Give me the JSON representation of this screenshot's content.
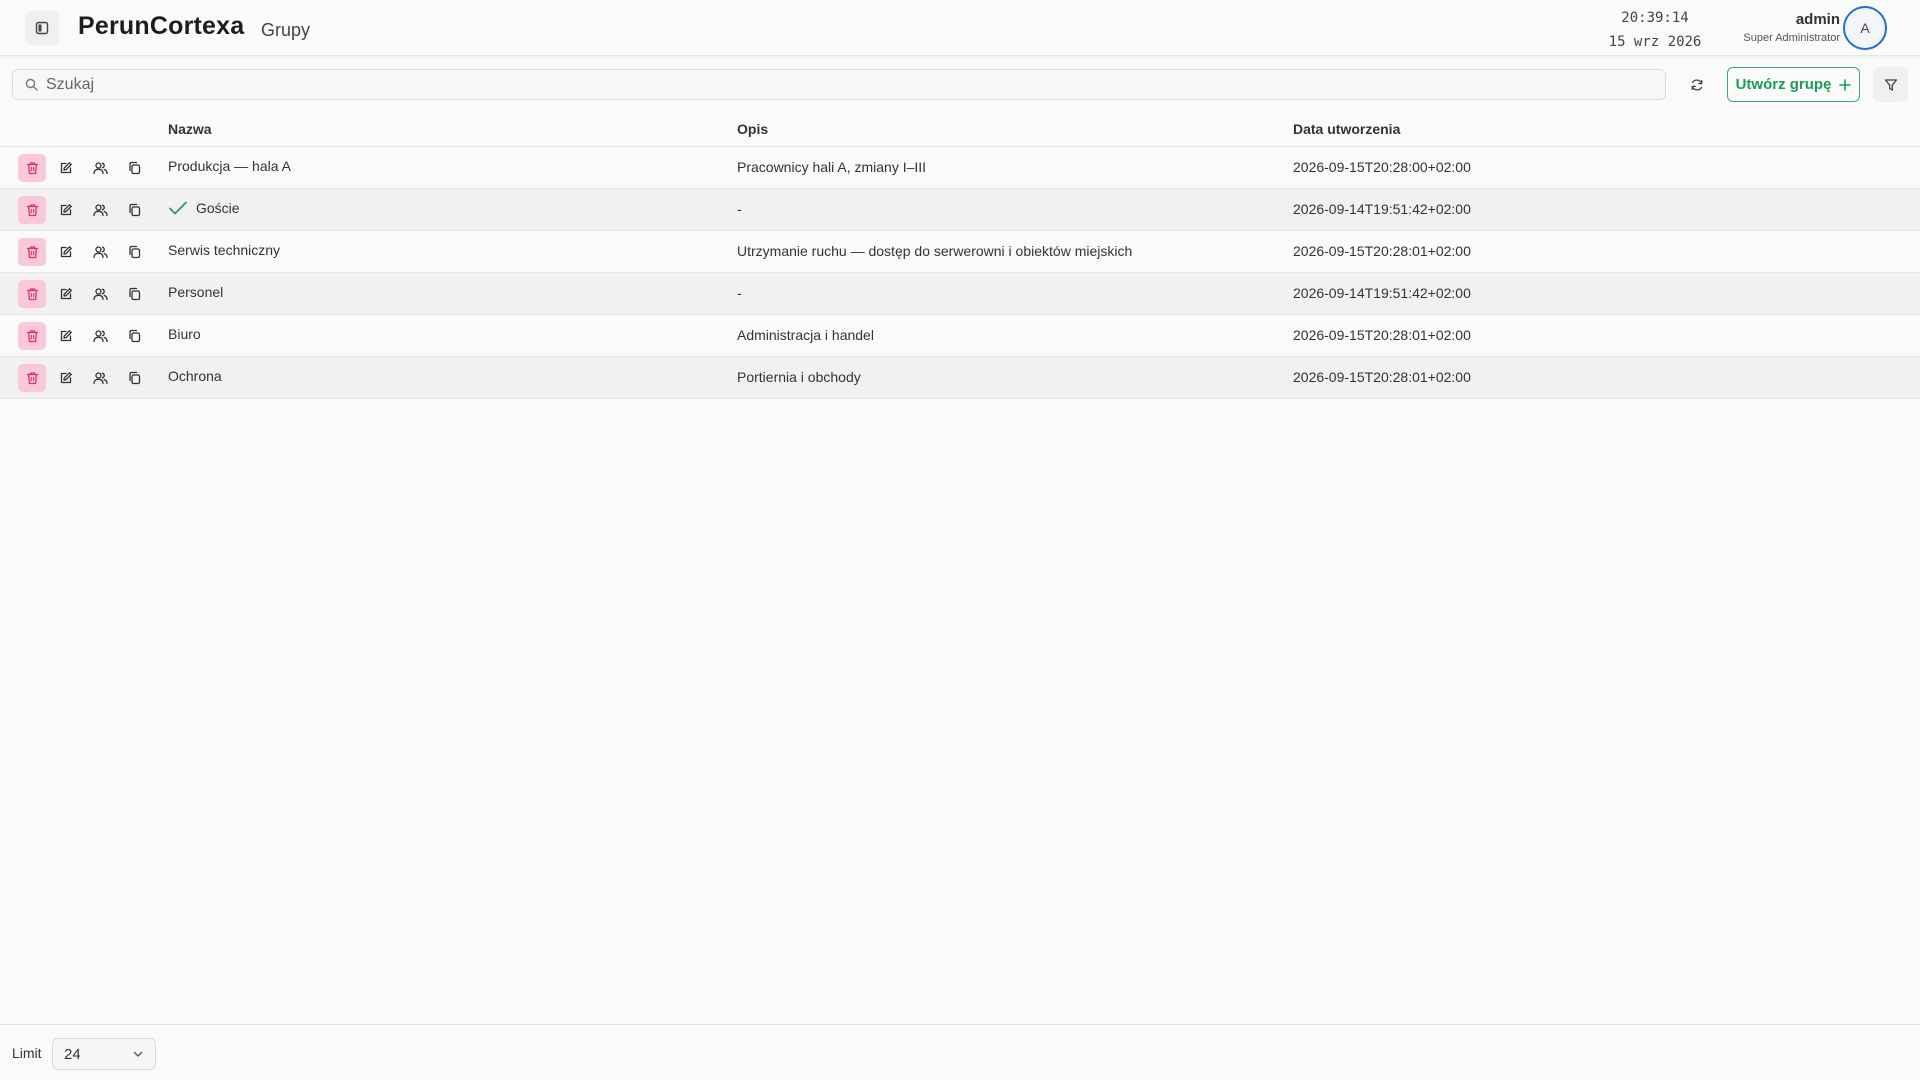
{
  "header": {
    "app_title": "PerunCortexa",
    "page_title": "Grupy",
    "clock_time": "20:39:14",
    "clock_date": "15 wrz 2026",
    "user_name": "admin",
    "user_role": "Super Administrator",
    "avatar_initial": "A"
  },
  "toolbar": {
    "search_placeholder": "Szukaj",
    "create_label": "Utwórz grupę"
  },
  "table": {
    "columns": [
      "Nazwa",
      "Opis",
      "Data utworzenia"
    ],
    "rows": [
      {
        "name": "Produkcja — hala A",
        "description": "Pracownicy hali A, zmiany I–III",
        "created": "2026-09-15T20:28:00+02:00",
        "checked": false
      },
      {
        "name": "Goście",
        "description": "-",
        "created": "2026-09-14T19:51:42+02:00",
        "checked": true
      },
      {
        "name": "Serwis techniczny",
        "description": "Utrzymanie ruchu — dostęp do serwerowni i obiektów miejskich",
        "created": "2026-09-15T20:28:01+02:00",
        "checked": false
      },
      {
        "name": "Personel",
        "description": "-",
        "created": "2026-09-14T19:51:42+02:00",
        "checked": false
      },
      {
        "name": "Biuro",
        "description": "Administracja i handel",
        "created": "2026-09-15T20:28:01+02:00",
        "checked": false
      },
      {
        "name": "Ochrona",
        "description": "Portiernia i obchody",
        "created": "2026-09-15T20:28:01+02:00",
        "checked": false
      }
    ]
  },
  "footer": {
    "limit_label": "Limit",
    "limit_value": "24"
  },
  "colors": {
    "accent_green": "#1f9a57",
    "delete_bg": "#f9c9d9",
    "delete_icon": "#d6336c",
    "avatar_ring": "#1f6fd1"
  }
}
